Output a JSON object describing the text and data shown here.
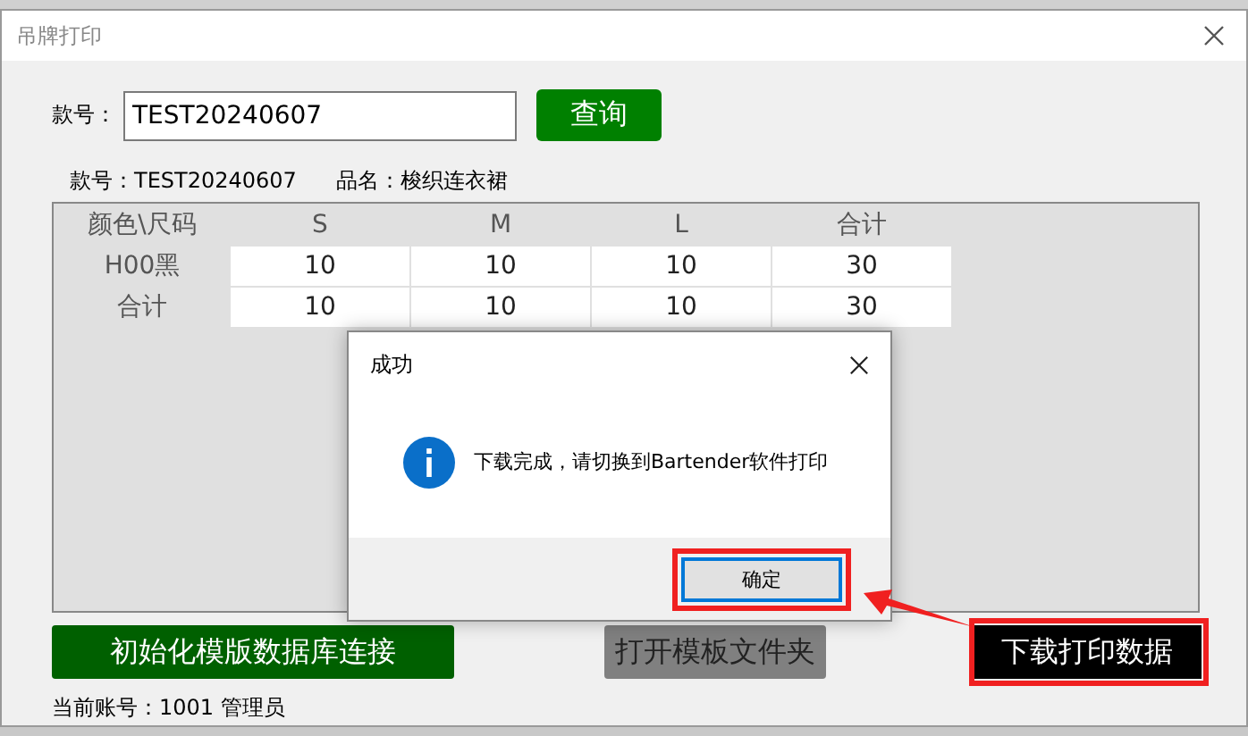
{
  "window": {
    "title": "吊牌打印"
  },
  "query": {
    "label": "款号：",
    "value": "TEST20240607",
    "button": "查询"
  },
  "info": [
    {
      "label": "款号：",
      "value": "TEST20240607"
    },
    {
      "label": "品名：",
      "value": "梭织连衣裙"
    }
  ],
  "table": {
    "columns": [
      "颜色\\尺码",
      "S",
      "M",
      "L",
      "合计"
    ],
    "rows": [
      {
        "cells": [
          "H00黑",
          "10",
          "10",
          "10",
          "30"
        ]
      },
      {
        "cells": [
          "合计",
          "10",
          "10",
          "10",
          "30"
        ]
      }
    ]
  },
  "dialog": {
    "title": "成功",
    "message": "下载完成，请切换到Bartender软件打印",
    "button": "确定",
    "highlighted": true
  },
  "buttons": [
    {
      "label": "初始化模版数据库连接",
      "kind": "green"
    },
    {
      "label": "打开模板文件夹",
      "kind": "gray"
    },
    {
      "label": "下载打印数据",
      "kind": "black",
      "highlighted": true
    }
  ],
  "status": "当前账号：1001 管理员"
}
